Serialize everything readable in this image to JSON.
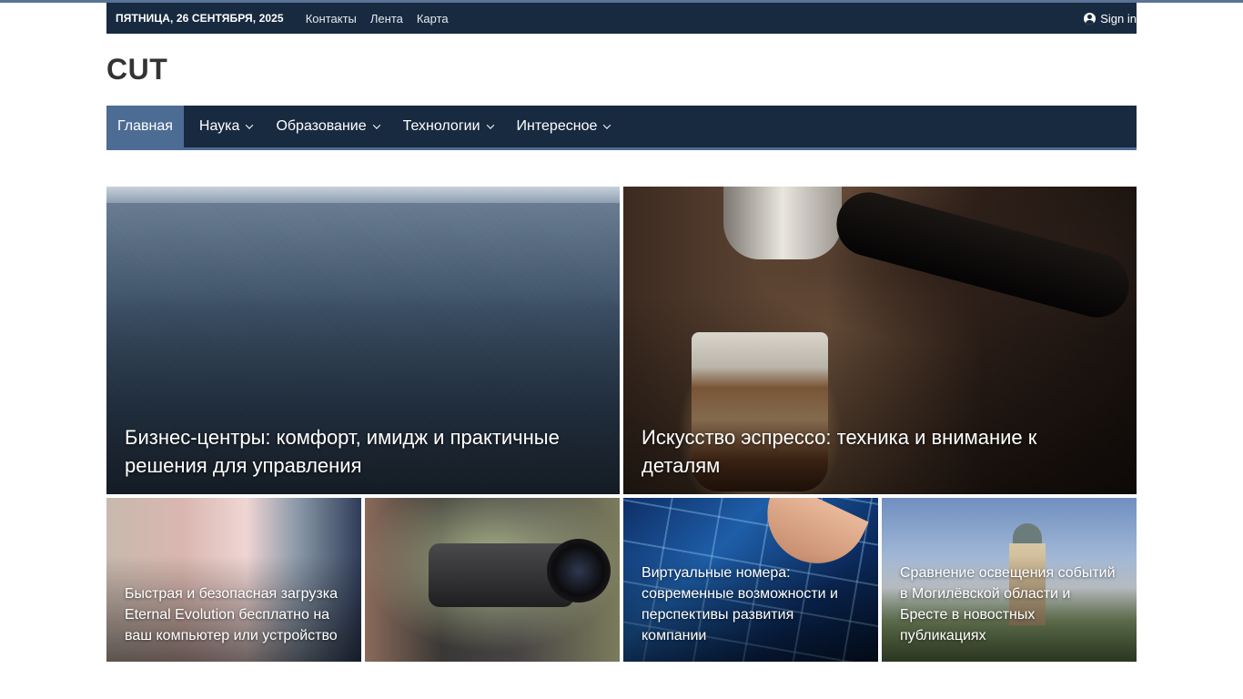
{
  "topbar": {
    "date": "ПЯТНИЦА, 26 СЕНТЯБРЯ, 2025",
    "links": [
      "Контакты",
      "Лента",
      "Карта"
    ],
    "signin": "Sign in"
  },
  "site": {
    "logo": "CUT"
  },
  "nav": {
    "items": [
      {
        "label": "Главная",
        "active": true,
        "has_dropdown": false
      },
      {
        "label": "Наука",
        "active": false,
        "has_dropdown": true
      },
      {
        "label": "Образование",
        "active": false,
        "has_dropdown": true
      },
      {
        "label": "Технологии",
        "active": false,
        "has_dropdown": true
      },
      {
        "label": "Интересное",
        "active": false,
        "has_dropdown": true
      }
    ]
  },
  "featured": {
    "big": [
      {
        "title": "Бизнес-центры: комфорт, имидж и практичные решения для управления"
      },
      {
        "title": "Искусство эспрессо: техника и внимание к деталям"
      }
    ],
    "small": [
      {
        "title": "Быстрая и безопасная загрузка Eternal Evolution бесплатно на ваш компьютер или устройство"
      },
      {
        "title": ""
      },
      {
        "title": "Виртуальные номера: современные возможности и перспективы развития компании"
      },
      {
        "title": "Сравнение освещения событий в Могилёвской области и Бресте в новостных публикациях"
      }
    ]
  },
  "colors": {
    "topbar_bg": "#182a40",
    "nav_active": "#4d6c94",
    "accent": "#5a7396"
  },
  "icons": {
    "signin": "user-circle-icon",
    "dropdown": "chevron-down-icon"
  }
}
